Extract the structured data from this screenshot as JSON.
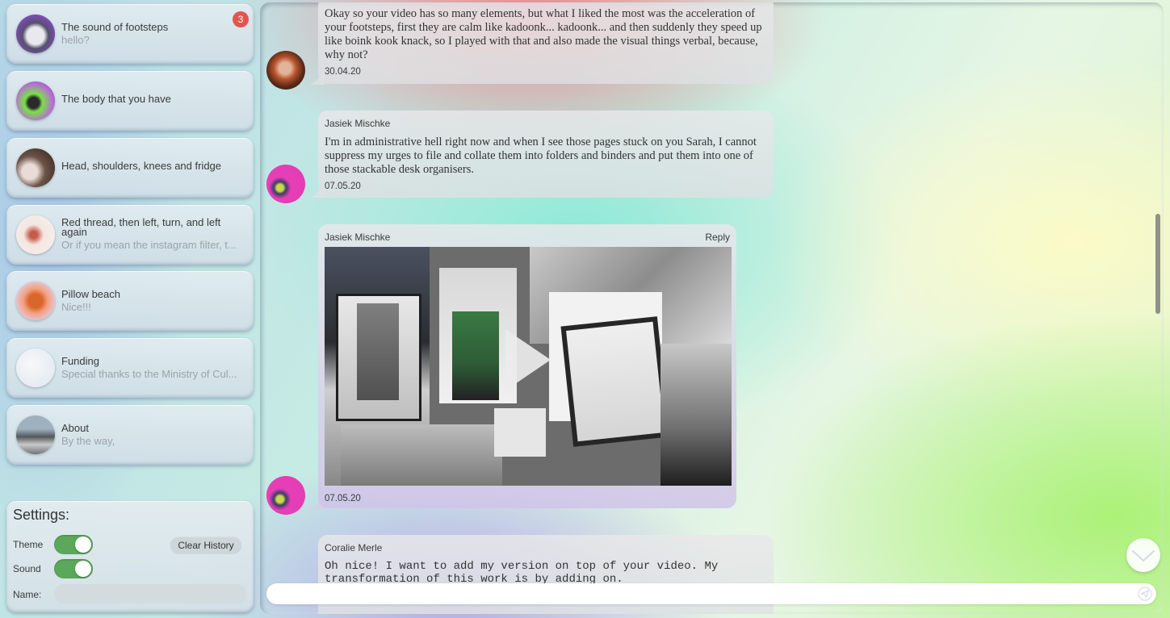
{
  "sidebar": {
    "conversations": [
      {
        "title": "The sound of footsteps",
        "preview": "hello?",
        "badge": "3"
      },
      {
        "title": "The body that you have",
        "preview": ""
      },
      {
        "title": "Head, shoulders, knees and fridge",
        "preview": ""
      },
      {
        "title": "Red thread, then left, turn, and left again",
        "preview": "Or if you mean the instagram filter, t..."
      },
      {
        "title": "Pillow beach",
        "preview": "Nice!!!"
      },
      {
        "title": "Funding",
        "preview": "Special thanks to the Ministry of Cul..."
      },
      {
        "title": "About",
        "preview": "By the way,"
      }
    ]
  },
  "settings": {
    "heading": "Settings:",
    "theme_label": "Theme",
    "theme_on": true,
    "sound_label": "Sound",
    "sound_on": true,
    "clear_history_label": "Clear History",
    "name_label": "Name:",
    "name_value": ""
  },
  "messages": [
    {
      "author": "",
      "body": "Okay so your video has so many elements, but what I liked the most was the acceleration of your footsteps, first they are calm like kadoonk... kadoonk... and then suddenly they speed up like boink kook knack, so I played with that and also made the visual things verbal, because, why not?",
      "date": "30.04.20"
    },
    {
      "author": "Jasiek Mischke",
      "body": "I'm in administrative hell right now and when I see those pages stuck on you Sarah, I cannot suppress my urges to file and collate them into folders and binders and put them into one of those stackable desk organisers.",
      "date": "07.05.20"
    },
    {
      "author": "Jasiek Mischke",
      "reply_label": "Reply",
      "date": "07.05.20"
    },
    {
      "author": "Coralie Merle",
      "body": "Oh nice! I want to add my version on top of your video. My transformation of this work is by adding on."
    }
  ],
  "composer": {
    "value": "",
    "placeholder": ""
  },
  "icons": {
    "scroll_down": "chevron-down-icon",
    "send": "send-icon",
    "play": "play-icon"
  },
  "colors": {
    "toggle_on": "#5ba85a",
    "badge": "#e0564f",
    "bubble": "#e4e5e7"
  }
}
